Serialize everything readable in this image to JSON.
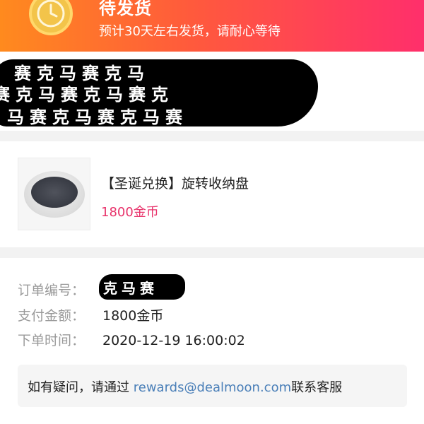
{
  "status": {
    "title": "待发货",
    "subtitle": "预计30天左右发货，请耐心等待",
    "icon": "clock-icon"
  },
  "redacted_address": {
    "line1": "赛克马赛克马",
    "line2": "赛克马赛克马赛克",
    "line3": "马赛克马赛克马赛"
  },
  "product": {
    "name": "【圣诞兑换】旋转收纳盘",
    "price": "1800金币"
  },
  "order": {
    "number_label": "订单编号：",
    "number_value": "克马赛",
    "amount_label": "支付金额：",
    "amount_value": "1800金币",
    "time_label": "下单时间：",
    "time_value": "2020-12-19 16:00:02"
  },
  "help": {
    "prefix": "如有疑问，请通过 ",
    "email": "rewards@dealmoon.com",
    "suffix": "联系客服"
  },
  "colors": {
    "header_start": "#ff8a1e",
    "header_end": "#ff2f6b",
    "price": "#e8336b",
    "link": "#4a7fb8"
  }
}
